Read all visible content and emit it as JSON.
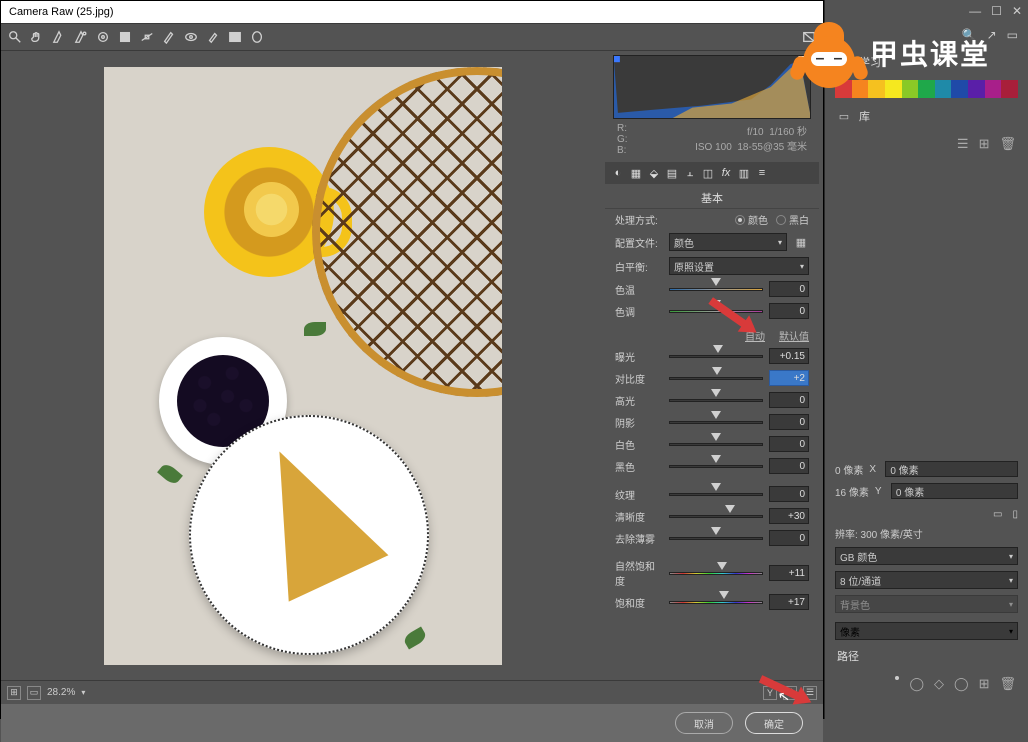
{
  "window": {
    "title": "Camera Raw (25.jpg)"
  },
  "logo": {
    "text": "甲虫课堂"
  },
  "meta": {
    "r": "R:",
    "g": "G:",
    "b": "B:",
    "aperture": "f/10",
    "shutter": "1/160 秒",
    "iso": "ISO 100",
    "lens": "18-55@35 毫米"
  },
  "section": {
    "title": "基本"
  },
  "treatment": {
    "label": "处理方式:",
    "color": "颜色",
    "bw": "黑白"
  },
  "profile": {
    "label": "配置文件:",
    "value": "颜色"
  },
  "wb": {
    "label": "白平衡:",
    "value": "原照设置"
  },
  "sliders": {
    "temp": {
      "label": "色温",
      "value": "0",
      "pos": 50
    },
    "tint": {
      "label": "色调",
      "value": "0",
      "pos": 50
    },
    "auto": {
      "auto": "自动",
      "default": "默认值"
    },
    "exposure": {
      "label": "曝光",
      "value": "+0.15",
      "pos": 52
    },
    "contrast": {
      "label": "对比度",
      "value": "+2",
      "pos": 51
    },
    "highlights": {
      "label": "高光",
      "value": "0",
      "pos": 50
    },
    "shadows": {
      "label": "阴影",
      "value": "0",
      "pos": 50
    },
    "whites": {
      "label": "白色",
      "value": "0",
      "pos": 50
    },
    "blacks": {
      "label": "黑色",
      "value": "0",
      "pos": 50
    },
    "texture": {
      "label": "纹理",
      "value": "0",
      "pos": 50
    },
    "clarity": {
      "label": "清晰度",
      "value": "+30",
      "pos": 65
    },
    "dehaze": {
      "label": "去除薄雾",
      "value": "0",
      "pos": 50
    },
    "vibrance": {
      "label": "自然饱和度",
      "value": "+11",
      "pos": 56
    },
    "saturation": {
      "label": "饱和度",
      "value": "+17",
      "pos": 59
    }
  },
  "status": {
    "zoom": "28.2%"
  },
  "footer": {
    "cancel": "取消",
    "ok": "确定"
  },
  "host": {
    "learn": "学习",
    "library": "库",
    "width_suffix": "0 像素",
    "height_prefix": "16 像素",
    "x": "X",
    "y": "Y",
    "resolution": "辨率: 300 像素/英寸",
    "colormode": "GB 颜色",
    "channels": "8 位/通道",
    "bgcolor": "背景色",
    "unit": "像素",
    "path": "路径"
  }
}
